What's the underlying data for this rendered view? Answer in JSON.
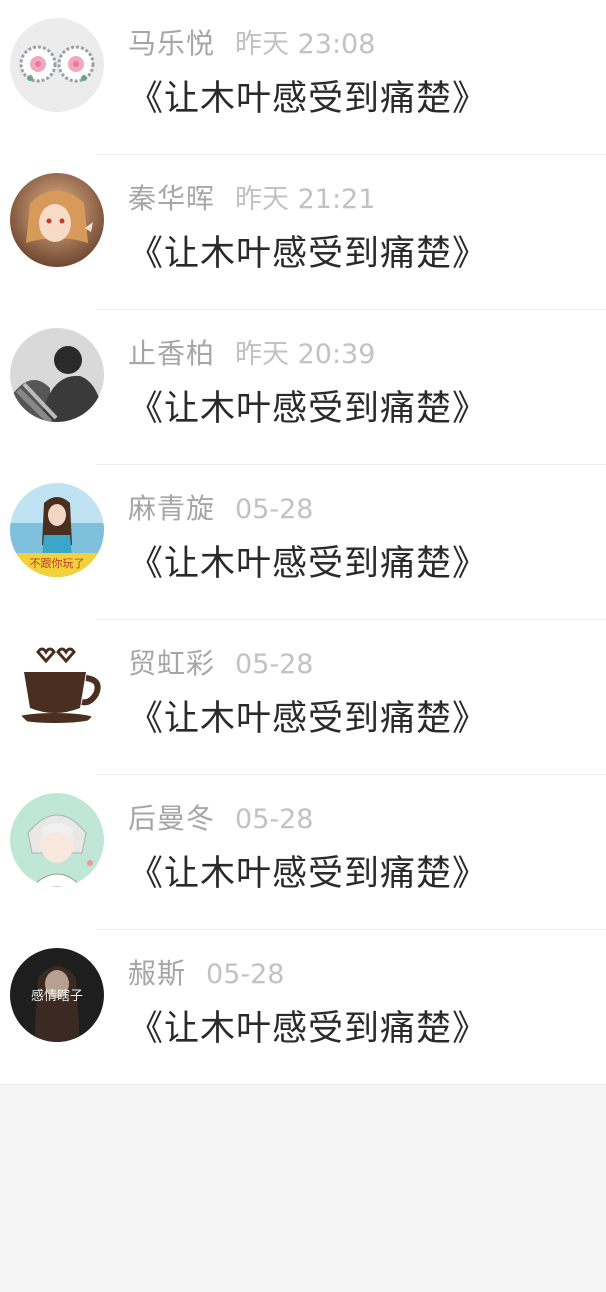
{
  "messages": [
    {
      "name": "马乐悦",
      "time": "昨天 23:08",
      "text": "《让木叶感受到痛楚》",
      "avatar": "earrings-avatar-icon"
    },
    {
      "name": "秦华晖",
      "time": "昨天 21:21",
      "text": "《让木叶感受到痛楚》",
      "avatar": "anime-girl-avatar-icon"
    },
    {
      "name": "止香柏",
      "time": "昨天 20:39",
      "text": "《让木叶感受到痛楚》",
      "avatar": "couple-avatar-icon"
    },
    {
      "name": "麻青旋",
      "time": "05-28",
      "text": "《让木叶感受到痛楚》",
      "avatar": "girl-photo-avatar-icon",
      "avatar_caption": "不跟你玩了"
    },
    {
      "name": "贸虹彩",
      "time": "05-28",
      "text": "《让木叶感受到痛楚》",
      "avatar": "coffee-cup-avatar-icon"
    },
    {
      "name": "后曼冬",
      "time": "05-28",
      "text": "《让木叶感受到痛楚》",
      "avatar": "anime-boy-avatar-icon"
    },
    {
      "name": "赧斯",
      "time": "05-28",
      "text": "《让木叶感受到痛楚》",
      "avatar": "dark-photo-avatar-icon",
      "avatar_caption": "感情瞎子"
    }
  ]
}
